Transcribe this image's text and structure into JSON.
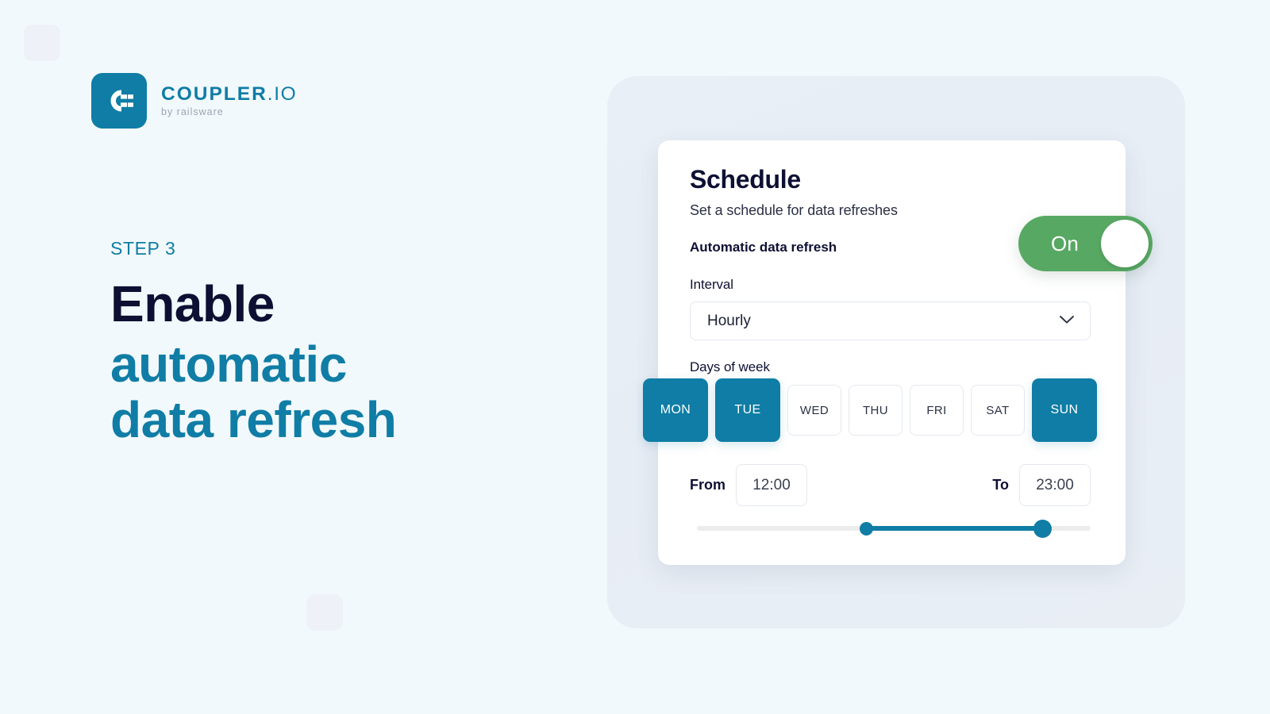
{
  "brand": {
    "wordmark_main": "COUPLER",
    "wordmark_suffix": ".IO",
    "tagline": "by railsware",
    "logo_icon": "coupler-connector-icon",
    "accent_teal": "#0f7da5",
    "accent_green": "#57a862",
    "dark": "#0d1033",
    "page_bg": "#f2f9fc",
    "panel_bg": "#e8eef5"
  },
  "copy": {
    "step_label": "STEP 3",
    "headline_dark": "Enable",
    "headline_teal_line1": "automatic",
    "headline_teal_line2": "data refresh"
  },
  "card": {
    "title": "Schedule",
    "subtitle": "Set a schedule for data refreshes",
    "auto_refresh_label": "Automatic data refresh",
    "toggle": {
      "state_label": "On",
      "enabled": true
    },
    "interval": {
      "label": "Interval",
      "value": "Hourly",
      "chevron_icon": "chevron-down-icon",
      "options": [
        "Hourly"
      ]
    },
    "days": {
      "label": "Days of week",
      "items": [
        {
          "label": "MON",
          "selected": true
        },
        {
          "label": "TUE",
          "selected": true
        },
        {
          "label": "WED",
          "selected": false
        },
        {
          "label": "THU",
          "selected": false
        },
        {
          "label": "FRI",
          "selected": false
        },
        {
          "label": "SAT",
          "selected": false
        },
        {
          "label": "SUN",
          "selected": true
        }
      ]
    },
    "time_range": {
      "from_label": "From",
      "from_value": "12:00",
      "to_label": "To",
      "to_value": "23:00",
      "slider": {
        "min": 0,
        "max": 24,
        "start": 12,
        "end": 23
      }
    }
  }
}
